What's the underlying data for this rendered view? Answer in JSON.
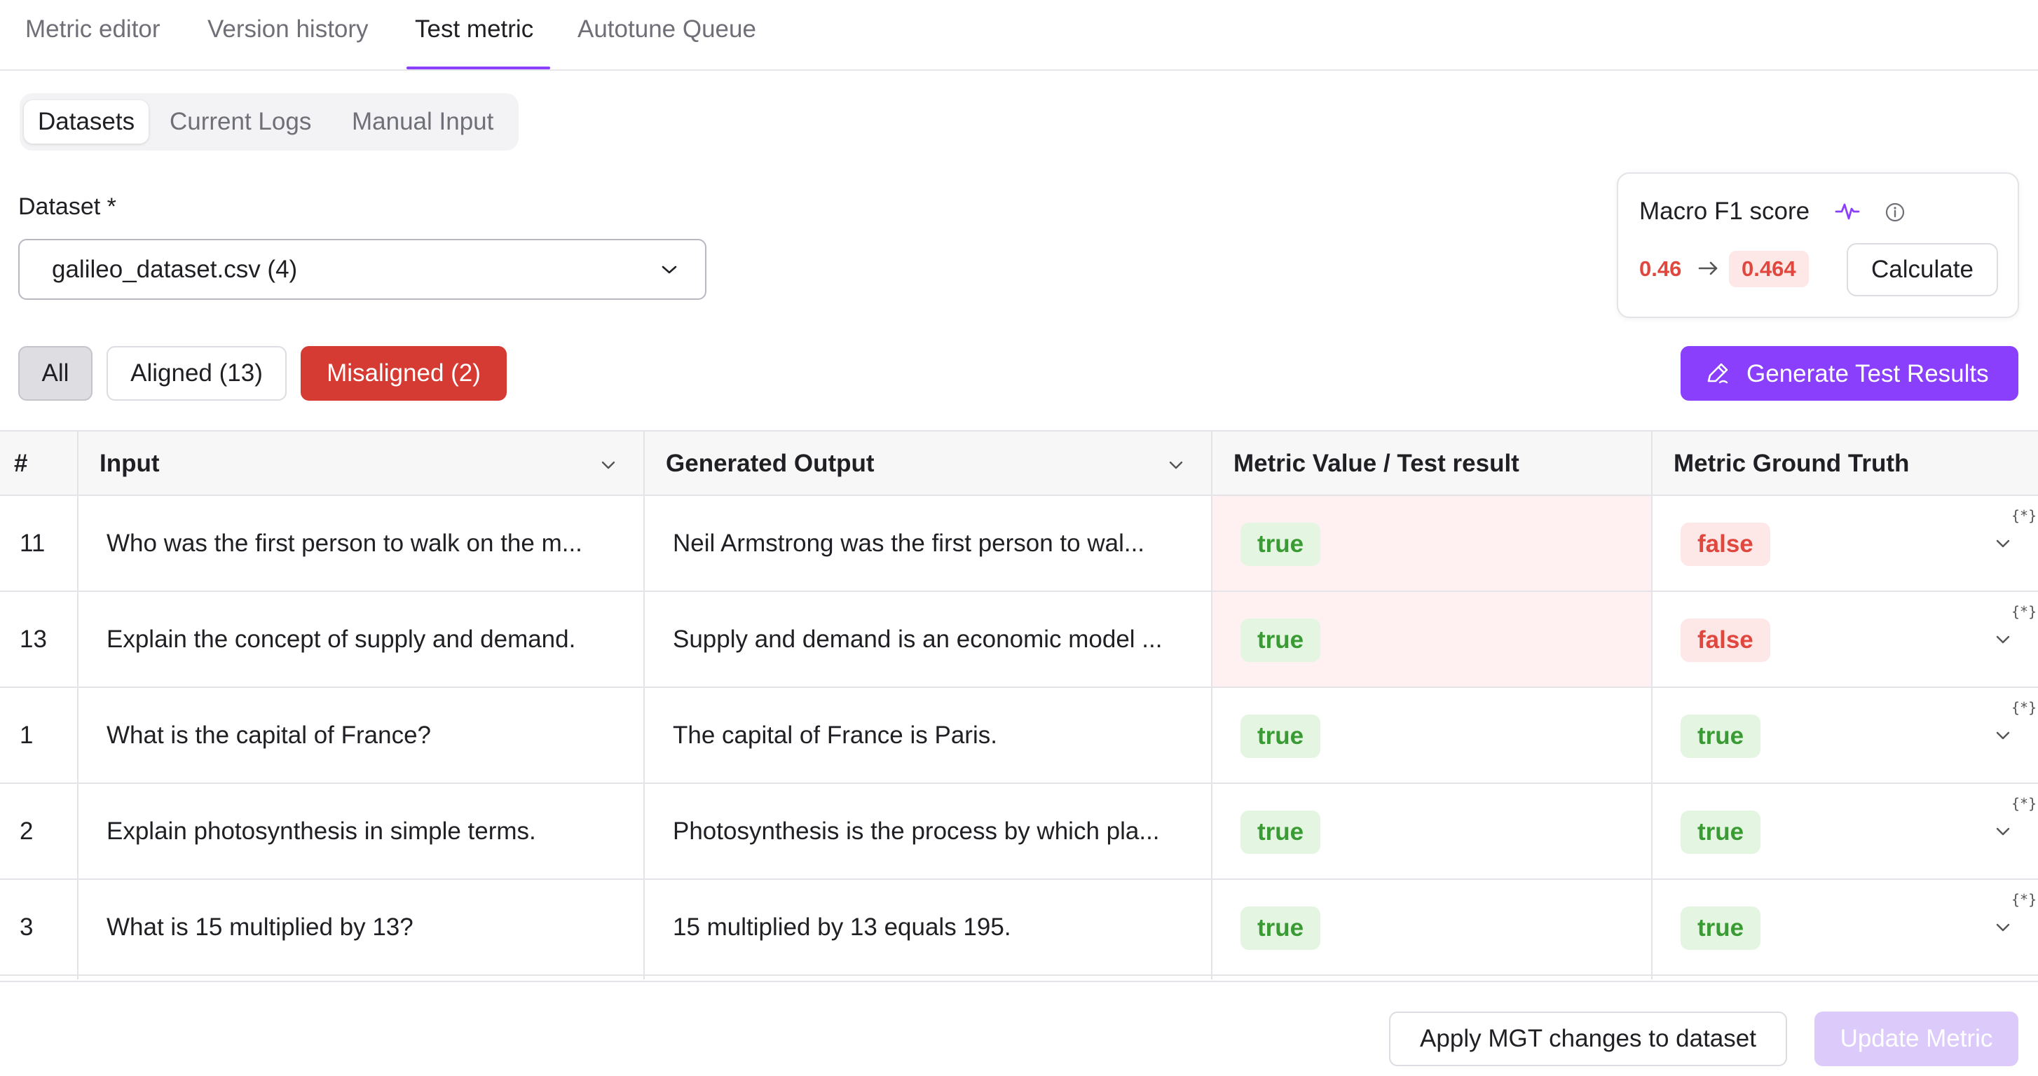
{
  "top_tabs": [
    {
      "label": "Metric editor"
    },
    {
      "label": "Version history"
    },
    {
      "label": "Test metric"
    },
    {
      "label": "Autotune Queue"
    }
  ],
  "active_top_tab": "Test metric",
  "sub_tabs": [
    {
      "label": "Datasets"
    },
    {
      "label": "Current Logs"
    },
    {
      "label": "Manual Input"
    }
  ],
  "active_sub_tab": "Datasets",
  "dataset": {
    "label": "Dataset *",
    "selected": "galileo_dataset.csv (4)"
  },
  "score_card": {
    "title": "Macro F1 score",
    "old_value": "0.46",
    "new_value": "0.464",
    "calculate_label": "Calculate"
  },
  "filters": {
    "all": "All",
    "aligned": "Aligned (13)",
    "misaligned": "Misaligned (2)"
  },
  "generate_label": "Generate Test Results",
  "table": {
    "headers": {
      "index": "#",
      "input": "Input",
      "output": "Generated Output",
      "metric_value": "Metric Value / Test result",
      "ground_truth": "Metric Ground Truth"
    },
    "rows": [
      {
        "id": "11",
        "input": "Who was the first person to walk on the m...",
        "output": "Neil Armstrong was the first person to wal...",
        "value": "true",
        "truth": "false",
        "misaligned": true,
        "json_tag": "{*}"
      },
      {
        "id": "13",
        "input": "Explain the concept of supply and demand.",
        "output": "Supply and demand is an economic model ...",
        "value": "true",
        "truth": "false",
        "misaligned": true,
        "json_tag": "{*}"
      },
      {
        "id": "1",
        "input": "What is the capital of France?",
        "output": "The capital of France is Paris.",
        "value": "true",
        "truth": "true",
        "misaligned": false,
        "json_tag": "{*}"
      },
      {
        "id": "2",
        "input": "Explain photosynthesis in simple terms.",
        "output": "Photosynthesis is the process by which pla...",
        "value": "true",
        "truth": "true",
        "misaligned": false,
        "json_tag": "{*}"
      },
      {
        "id": "3",
        "input": "What is 15 multiplied by 13?",
        "output": "15 multiplied by 13 equals 195.",
        "value": "true",
        "truth": "true",
        "misaligned": false,
        "json_tag": "{*}"
      }
    ]
  },
  "footer": {
    "apply_label": "Apply MGT changes to dataset",
    "update_label": "Update Metric"
  },
  "colors": {
    "accent": "#8a3ffc",
    "danger": "#d63b33",
    "true_text": "#3a9a34",
    "false_text": "#e0473e"
  }
}
